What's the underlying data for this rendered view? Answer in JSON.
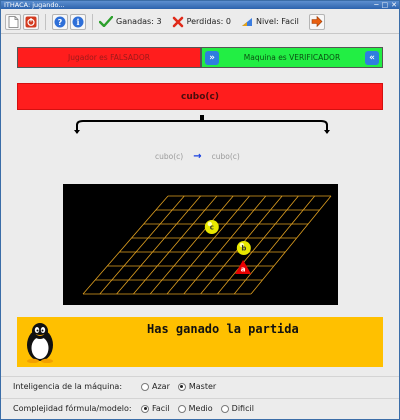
{
  "window": {
    "title": "ITHACA: jugando...",
    "controls": [
      "─",
      "□",
      "✕"
    ]
  },
  "toolbar": {
    "buttons": [
      {
        "name": "new-document-icon"
      },
      {
        "name": "stop-icon"
      },
      {
        "name": "help-icon"
      },
      {
        "name": "info-icon"
      }
    ],
    "stats": {
      "won_label": "Ganadas: 3",
      "lost_label": "Perdidas: 0",
      "level_label": "Nivel: Facil"
    },
    "exit_icon": "exit-arrow-icon"
  },
  "players": {
    "left_label": "Jugador es FALSADOR",
    "right_label": "Maquina es VERIFICADOR",
    "swap_glyph": "»",
    "swap_back_glyph": "«"
  },
  "formula": {
    "main": "cubo(c)",
    "left_term": "cubo(c)",
    "right_term": "cubo(c)",
    "arrow": "→"
  },
  "board": {
    "grid_color": "#e0a020",
    "grid_columns": 10,
    "grid_rows": 7,
    "pieces": [
      {
        "label": "c",
        "shape": "sphere",
        "color": "#e8e800",
        "column": 4,
        "row": 2.5
      },
      {
        "label": "b",
        "shape": "sphere",
        "color": "#e8e800",
        "column": 7,
        "row": 4
      },
      {
        "label": "a",
        "shape": "pyramid",
        "color": "#e80000",
        "column": 8,
        "row": 5.5
      }
    ]
  },
  "message": {
    "text": "Has ganado la partida",
    "background": "#ffc000"
  },
  "options": {
    "intelligence": {
      "label": "Inteligencia de la máquina:",
      "choices": [
        "Azar",
        "Master"
      ],
      "selected": "Master"
    },
    "complexity": {
      "label": "Complejidad fórmula/modelo:",
      "choices": [
        "Facil",
        "Medio",
        "Dificil"
      ],
      "selected": "Facil"
    }
  }
}
